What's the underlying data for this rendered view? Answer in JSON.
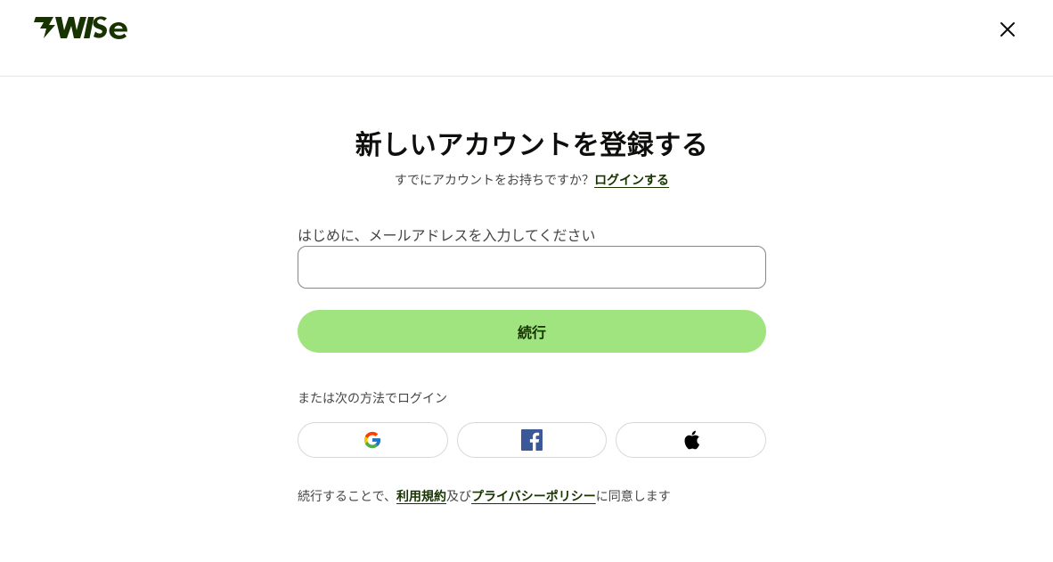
{
  "header": {
    "logo_text": "WISE",
    "close_icon": "close-icon"
  },
  "main": {
    "title": "新しいアカウントを登録する",
    "subtitle_prefix": "すでにアカウントをお持ちですか？",
    "login_link": "ログインする",
    "email_label": "はじめに、メールアドレスを入力してください",
    "email_value": "",
    "continue_label": "続行",
    "or_label": "または次の方法でログイン",
    "social": [
      {
        "name": "google",
        "icon": "google-icon"
      },
      {
        "name": "facebook",
        "icon": "facebook-icon"
      },
      {
        "name": "apple",
        "icon": "apple-icon"
      }
    ],
    "terms_prefix": "続行することで、",
    "terms_link": "利用規約",
    "terms_and": "及び",
    "privacy_link": "プライバシーポリシー",
    "terms_suffix": "に同意します"
  },
  "colors": {
    "brand_dark_green": "#163300",
    "brand_bright_green": "#a0e480",
    "text": "#0e0f0c",
    "muted_text": "#454745"
  }
}
